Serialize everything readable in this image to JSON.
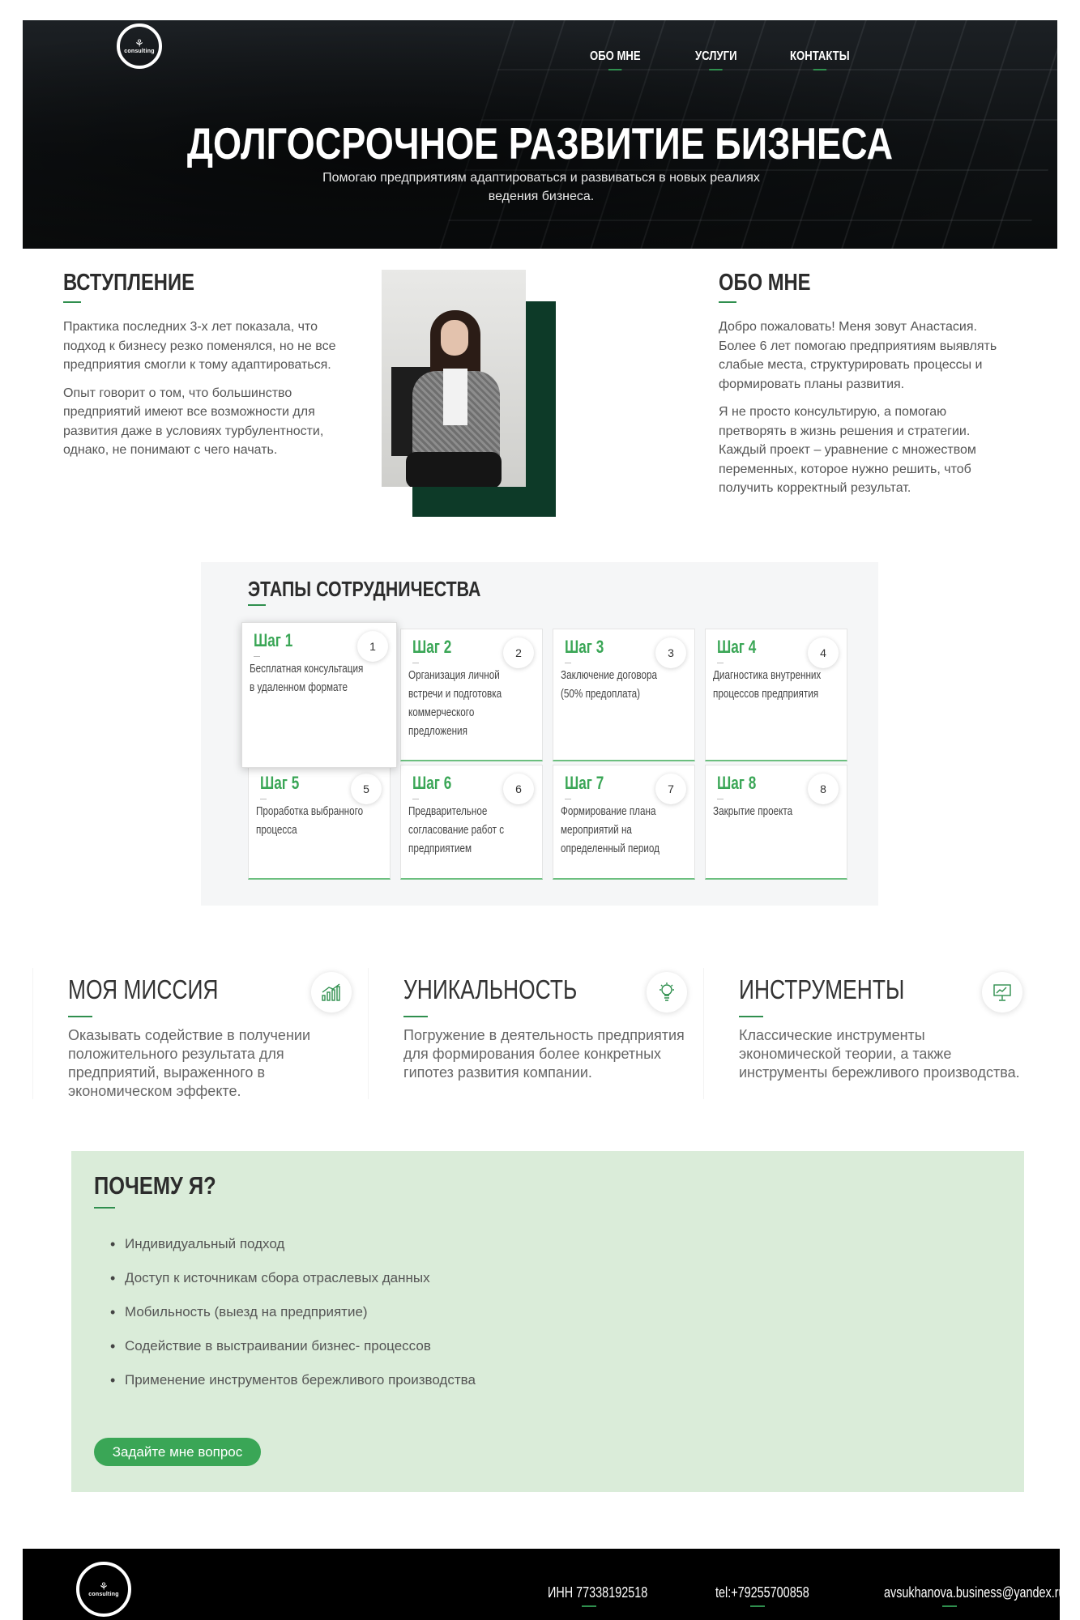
{
  "header": {
    "logo_word": "consulting",
    "nav": [
      {
        "label": "ОБО МНЕ"
      },
      {
        "label": "УСЛУГИ"
      },
      {
        "label": "КОНТАКТЫ"
      }
    ],
    "title": "ДОЛГОСРОЧНОЕ РАЗВИТИЕ БИЗНЕСА",
    "subtitle": "Помогаю предприятиям адаптироваться и развиваться в новых реалиях ведения бизнеса."
  },
  "intro": {
    "heading": "ВСТУПЛЕНИЕ",
    "p1": "Практика последних 3-х лет показала, что подход к бизнесу резко поменялся, но не все предприятия смогли к тому адаптироваться.",
    "p2": "Опыт говорит о том, что большинство предприятий имеют все возможности для развития даже в условиях турбулентности, однако, не понимают с чего начать."
  },
  "about": {
    "heading": "ОБО МНЕ",
    "p1": "Добро пожаловать! Меня зовут Анастасия. Более 6 лет помогаю предприятиям выявлять слабые места, структурировать процессы и формировать планы развития.",
    "p2": "Я не просто консультирую, а помогаю претворять в жизнь решения и стратегии. Каждый проект – уравнение с множеством переменных, которое нужно решить, чтоб получить корректный результат."
  },
  "steps": {
    "heading": "ЭТАПЫ СОТРУДНИЧЕСТВА",
    "items": [
      {
        "title": "Шаг 1",
        "num": "1",
        "desc": "Бесплатная консультация в удаленном формате"
      },
      {
        "title": "Шаг 2",
        "num": "2",
        "desc": "Организация личной встречи и подготовка коммерческого предложения"
      },
      {
        "title": "Шаг 3",
        "num": "3",
        "desc": "Заключение договора (50% предоплата)"
      },
      {
        "title": "Шаг 4",
        "num": "4",
        "desc": "Диагностика внутренних процессов предприятия"
      },
      {
        "title": "Шаг 5",
        "num": "5",
        "desc": "Проработка выбранного процесса"
      },
      {
        "title": "Шаг 6",
        "num": "6",
        "desc": "Предварительное согласование работ с предприятием"
      },
      {
        "title": "Шаг 7",
        "num": "7",
        "desc": "Формирование плана мероприятий на определенный период"
      },
      {
        "title": "Шаг 8",
        "num": "8",
        "desc": "Закрытие проекта"
      }
    ]
  },
  "features": [
    {
      "title": "МОЯ МИССИЯ",
      "desc": "Оказывать содействие в получении положительного результата для предприятий, выраженного в экономическом эффекте.",
      "icon": "growth-chart-icon"
    },
    {
      "title": "УНИКАЛЬНОСТЬ",
      "desc": "Погружение в деятельность предприятия для формирования более конкретных гипотез развития компании.",
      "icon": "lightbulb-icon"
    },
    {
      "title": "ИНСТРУМЕНТЫ",
      "desc": "Классические инструменты экономической теории, а также инструменты бережливого производства.",
      "icon": "presentation-board-icon"
    }
  ],
  "why": {
    "heading": "ПОЧЕМУ Я?",
    "items": [
      "Индивидуальный подход",
      "Доступ к источникам сбора отраслевых данных",
      "Мобильность (выезд на предприятие)",
      "Содействие в выстраивании бизнес- процессов",
      "Применение инструментов бережливого производства"
    ],
    "button": "Задайте мне вопрос"
  },
  "footer": {
    "inn": "ИНН 77338192518",
    "phone": "tel:+79255700858",
    "email": "avsukhanova.business@yandex.ru"
  },
  "colors": {
    "accent_green": "#3aa656",
    "dark_green": "#0d3a28",
    "why_bg": "#daecd9",
    "hero_bg": "#0f1214"
  }
}
